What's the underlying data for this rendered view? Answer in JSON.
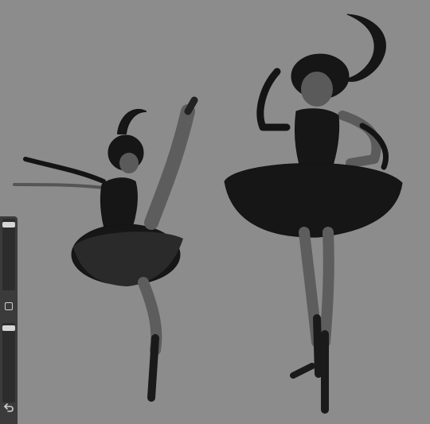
{
  "app": {
    "accent": "#d6d6d6",
    "canvas_color": "#8c8c8c",
    "toolbar_color": "#3b3b3b"
  },
  "toolbar": {
    "brush_size": {
      "level": 0.05
    },
    "modify_button": {
      "icon": "square-icon"
    },
    "brush_opacity": {
      "level": 0.03
    },
    "undo_button": {
      "icon": "undo-icon"
    }
  },
  "artwork": {
    "figures": [
      "ballerina-arabesque",
      "ballerina-standing"
    ]
  }
}
